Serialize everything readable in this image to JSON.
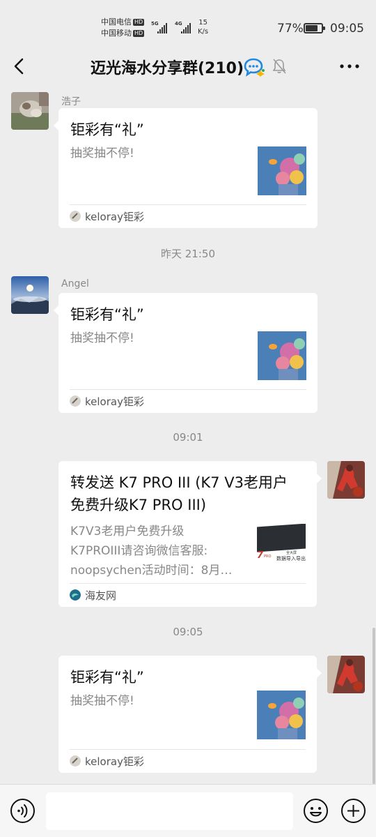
{
  "status_bar": {
    "carrier1": "中国电信",
    "carrier2": "中国移动",
    "hd": "HD",
    "net1": "5G",
    "net2": "4G",
    "net_speed_value": "15",
    "net_speed_unit": "K/s",
    "battery": "77%",
    "battery_level": 0.77,
    "time": "09:05"
  },
  "header": {
    "title": "迈光海水分享群(210)",
    "icons": [
      "back-icon",
      "chat-bubble-icon",
      "mute-bell-icon",
      "more-icon"
    ]
  },
  "messages": [
    {
      "sender": "浩子",
      "card_title": "钜彩有“礼”",
      "card_desc": "抽奖抽不停!",
      "source": "keloray钜彩"
    },
    {
      "time": "昨天 21:50"
    },
    {
      "sender": "Angel",
      "card_title": "钜彩有“礼”",
      "card_desc": "抽奖抽不停!",
      "source": "keloray钜彩"
    },
    {
      "time": "09:01"
    },
    {
      "card_title_line1": "转发送 K7 PRO III (K7 V3老用户",
      "card_title_line2": "免费升级K7 PRO III)",
      "desc_line1": "K7V3老用户免费升级",
      "desc_line2": "K7PROIII请咨询微信客服:",
      "desc_line3": "noopsychen活动时间：8月…",
      "thumb_text1": "7",
      "thumb_text2": "PRO",
      "thumb_text3": "数据导入导出",
      "thumb_text4": "全大屏",
      "source": "海友网"
    },
    {
      "time": "09:05"
    },
    {
      "card_title": "钜彩有“礼”",
      "card_desc": "抽奖抽不停!",
      "source": "keloray钜彩"
    }
  ],
  "input_bar": {
    "placeholder": "",
    "icons": [
      "voice-icon",
      "emoji-icon",
      "plus-icon"
    ]
  },
  "colors": {
    "background": "#ededed",
    "card": "#ffffff",
    "thumb_blue": "#4a7fb8",
    "wechat_blue": "#1e88e5"
  }
}
